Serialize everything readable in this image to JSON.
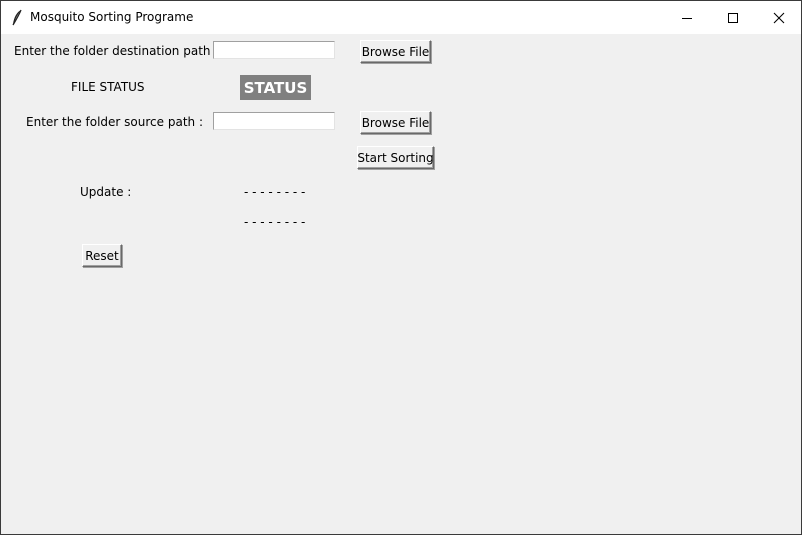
{
  "window": {
    "title": "Mosquito Sorting Programe",
    "icons": [
      "feather-icon",
      "minimize-icon",
      "maximize-icon",
      "close-icon"
    ]
  },
  "form": {
    "destination_label": "Enter the folder destination path :",
    "destination_value": "",
    "destination_browse_label": "Browse File",
    "file_status_label": "FILE STATUS",
    "status_badge": "STATUS",
    "source_label": "Enter the folder source path :",
    "source_value": "",
    "source_browse_label": "Browse File",
    "start_sorting_label": "Start Sorting",
    "update_label": "Update :",
    "update_line_1": "- - - - - - - -",
    "update_line_2": "- - - - - - - -",
    "reset_label": "Reset"
  },
  "colors": {
    "window_bg": "#f0f0f0",
    "titlebar_bg": "#ffffff",
    "status_badge_bg": "#808080",
    "status_badge_fg": "#ffffff"
  }
}
